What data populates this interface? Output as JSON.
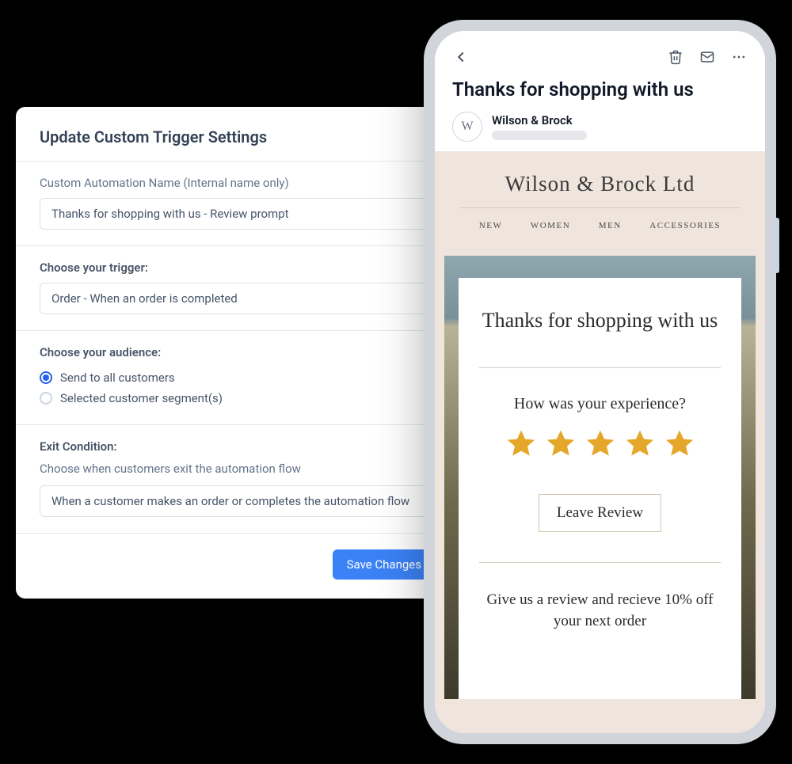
{
  "panel": {
    "title": "Update Custom Trigger Settings",
    "name_label": "Custom Automation Name (Internal name only)",
    "name_value": "Thanks for shopping with us - Review prompt",
    "trigger_label": "Choose your trigger:",
    "trigger_value": "Order - When an order is completed",
    "audience_label": "Choose your audience:",
    "audience_options": [
      {
        "label": "Send to all customers",
        "checked": true
      },
      {
        "label": "Selected customer segment(s)",
        "checked": false
      }
    ],
    "exit_label": "Exit Condition:",
    "exit_help": "Choose when customers exit the automation flow",
    "exit_value": "When a customer makes an order or completes the automation flow",
    "save_label": "Save Changes"
  },
  "mail": {
    "subject": "Thanks for shopping with us",
    "sender_name": "Wilson & Brock",
    "avatar_initial": "W"
  },
  "email": {
    "brand": "Wilson & Brock Ltd",
    "nav": [
      "NEW",
      "WOMEN",
      "MEN",
      "ACCESSORIES"
    ],
    "card_title": "Thanks for shopping with us",
    "card_subtitle": "How was your experience?",
    "review_button": "Leave Review",
    "card_description": "Give us a review and recieve 10% off your next order",
    "star_count": 5
  }
}
